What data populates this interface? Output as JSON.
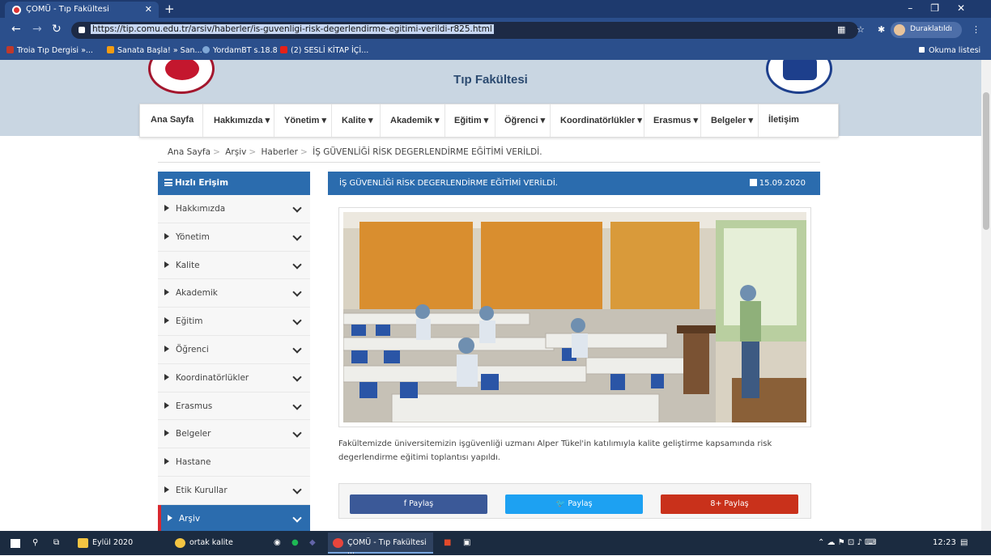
{
  "browser": {
    "tab_title": "ÇOMÜ - Tıp Fakültesi",
    "url": "https://tip.comu.edu.tr/arsiv/haberler/is-guvenligi-risk-degerlendirme-egitimi-verildi-r825.html",
    "profile_label": "Duraklatıldı",
    "reading_list": "Okuma listesi",
    "bookmarks": [
      "Troia Tıp Dergisi »...",
      "Sanata Başla! » San...",
      "YordamBT s.18.8",
      "(2) SESLİ KİTAP İÇİ..."
    ]
  },
  "site": {
    "title": "Tıp Fakültesi"
  },
  "nav": [
    "Ana Sayfa",
    "Hakkımızda ▾",
    "Yönetim ▾",
    "Kalite ▾",
    "Akademik ▾",
    "Eğitim ▾",
    "Öğrenci ▾",
    "Koordinatörlükler ▾",
    "Erasmus ▾",
    "Belgeler ▾",
    "İletişim"
  ],
  "breadcrumb": [
    "Ana Sayfa",
    "Arşiv",
    "Haberler",
    "İŞ GÜVENLİĞİ RİSK DEGERLENDİRME EĞİTİMİ VERİLDİ."
  ],
  "sidebar": {
    "heading": "Hızlı Erişim",
    "items": [
      "Hakkımızda",
      "Yönetim",
      "Kalite",
      "Akademik",
      "Eğitim",
      "Öğrenci",
      "Koordinatörlükler",
      "Erasmus",
      "Belgeler",
      "Hastane",
      "Etik Kurullar",
      "Arşiv"
    ]
  },
  "article": {
    "title": "İŞ GÜVENLİĞİ RİSK DEGERLENDİRME EĞİTİMİ VERİLDİ.",
    "date": "15.09.2020",
    "body": "Fakültemizde üniversitemizin işgüvenliği uzmanı Alper Tükel'in katılımıyla kalite geliştirme kapsamında risk degerlendirme eğitimi toplantısı yapıldı."
  },
  "share": {
    "facebook": "f Paylaş",
    "twitter": "Paylaş",
    "google": "8+ Paylaş"
  },
  "taskbar": {
    "apps": [
      "Eylül 2020",
      "ortak kalite",
      "ÇOMÜ - Tıp Fakültesi ..."
    ],
    "time": "12:23"
  }
}
